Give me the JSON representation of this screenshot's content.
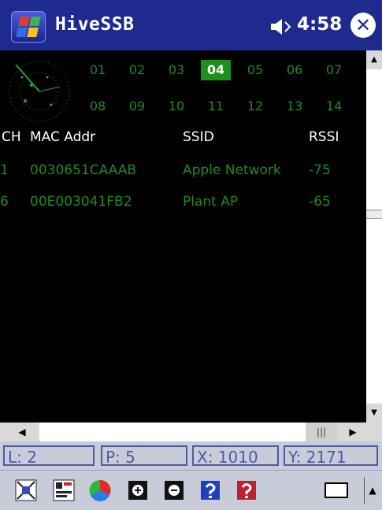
{
  "title_bar": {
    "app_title": "HiveSSB",
    "time": "4:58",
    "start_icon": "windows-flag-icon",
    "volume_icon": "speaker-icon",
    "close_label": "✕"
  },
  "channels": {
    "row1": [
      "01",
      "02",
      "03",
      "04",
      "05",
      "06",
      "07"
    ],
    "row2": [
      "08",
      "09",
      "10",
      "11",
      "12",
      "13",
      "14"
    ],
    "selected": "04"
  },
  "table": {
    "headers": {
      "ch": "CH",
      "mac": "MAC Addr",
      "ssid": "SSID",
      "rssi": "RSSI"
    },
    "rows": [
      {
        "ch": "1",
        "mac": "0030651CAAAB",
        "ssid": "Apple Network",
        "rssi": "-75"
      },
      {
        "ch": "6",
        "mac": "00E003041FB2",
        "ssid": "Plant AP",
        "rssi": "-65"
      }
    ]
  },
  "status": {
    "l": "L: 2",
    "p": "P: 5",
    "x": "X: 1010",
    "y": "Y: 2171"
  },
  "toolbar": {
    "icons": [
      "grid-capture-icon",
      "chart-view-icon",
      "color-wheel-icon",
      "zoom-in-icon",
      "zoom-out-icon",
      "help-icon",
      "help-alt-icon",
      "keyboard-icon"
    ]
  },
  "colors": {
    "title_bar": "#1f2a8f",
    "data_green": "#1f8a22",
    "status_text": "#4f5aa6"
  }
}
